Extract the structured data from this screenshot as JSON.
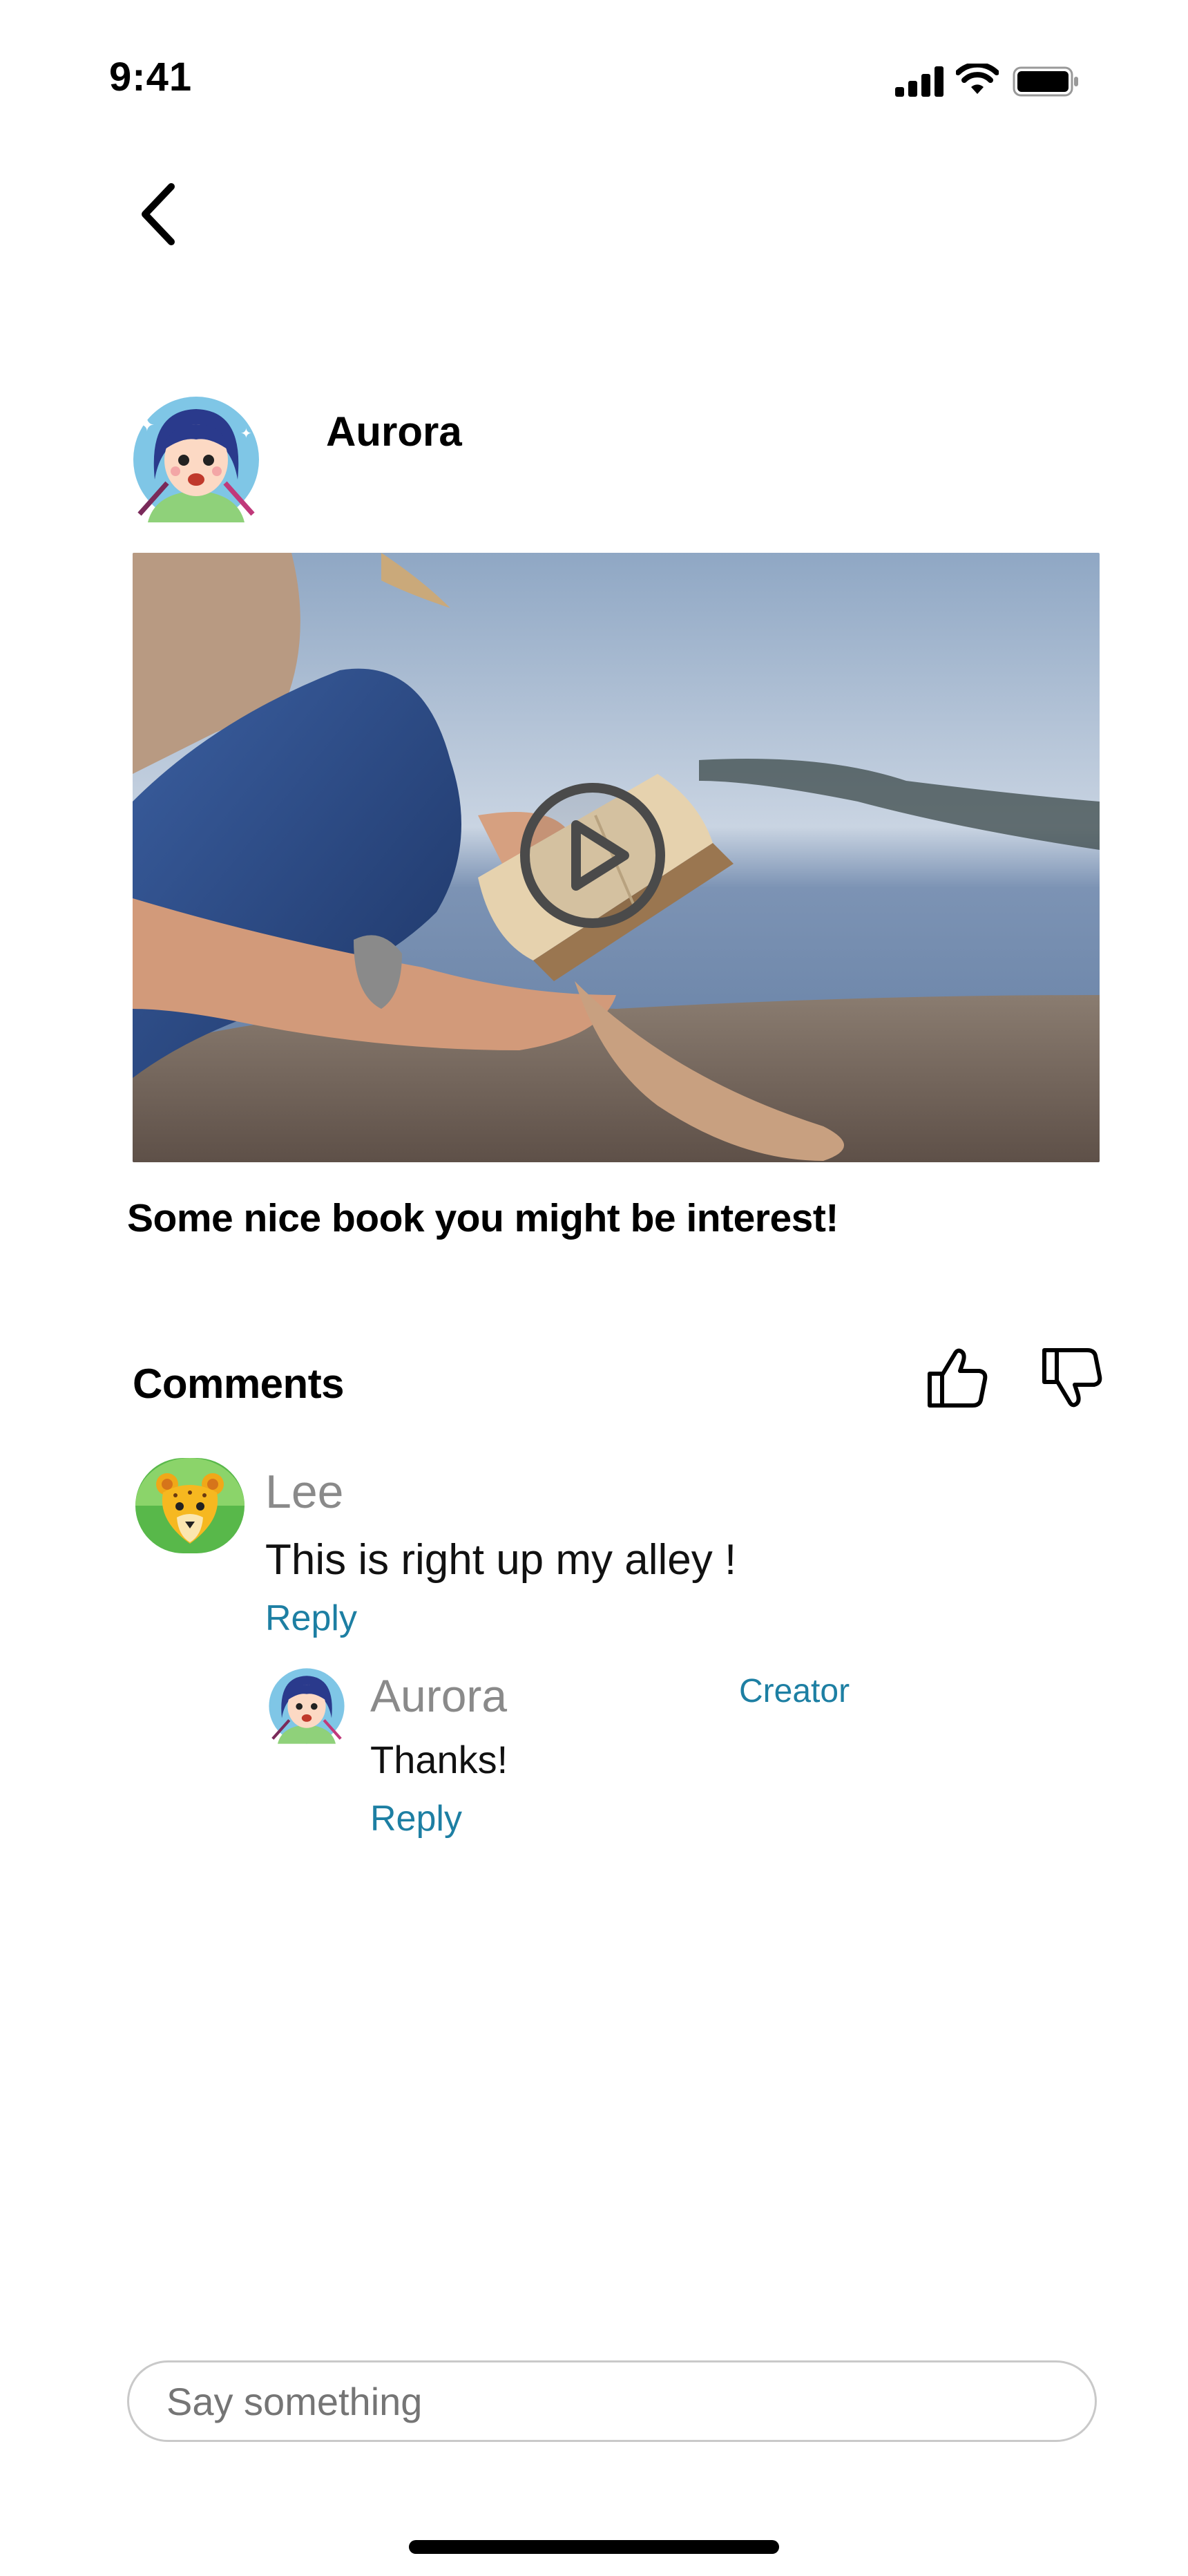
{
  "status_bar": {
    "time": "9:41"
  },
  "post": {
    "author": "Aurora",
    "caption": "Some nice book you might be interest!"
  },
  "comments": {
    "title": "Comments",
    "items": [
      {
        "author": "Lee",
        "text": "This is right up my alley !",
        "reply_label": "Reply",
        "replies": [
          {
            "author": "Aurora",
            "badge": "Creator",
            "text": "Thanks!",
            "reply_label": "Reply"
          }
        ]
      }
    ]
  },
  "composer": {
    "placeholder": "Say something"
  },
  "icons": {
    "back": "chevron-left-icon",
    "play": "play-icon",
    "like": "thumbs-up-icon",
    "dislike": "thumbs-down-icon"
  },
  "colors": {
    "link": "#1d7fa3",
    "muted": "#8a8a8a"
  }
}
